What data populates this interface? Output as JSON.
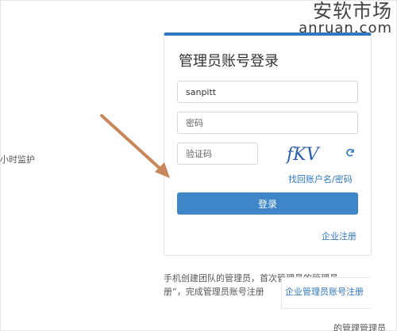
{
  "watermark": {
    "cn": "安软市场",
    "en": "anruan.com"
  },
  "left_text": "小时监护",
  "login": {
    "title": "管理员账号登录",
    "username_value": "sanpitt",
    "password_placeholder": "密码",
    "captcha_placeholder": "验证码",
    "captcha_text": "fKV",
    "forgot_link": "找回账户名/密码",
    "login_button": "登录",
    "enterprise_register": "企业注册"
  },
  "footer": {
    "line1": "手机创建团队的管理员，首次管理员的管理员，",
    "line2": "册”，完成管理员账号注册",
    "box_link": "企业管理员账号注册",
    "cut_text": "的管理管理员"
  },
  "colors": {
    "accent": "#2f77bf",
    "button": "#3f86c9",
    "arrow": "#c8875a"
  }
}
